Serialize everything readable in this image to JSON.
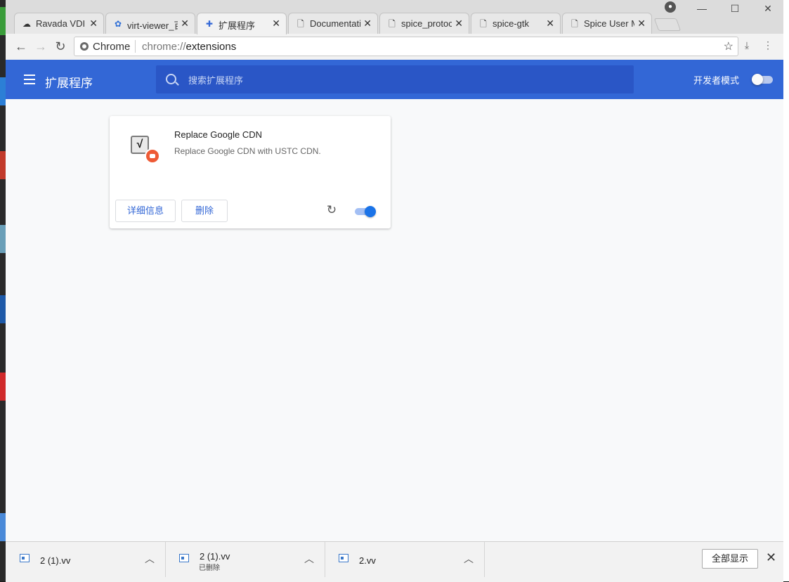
{
  "tabs": [
    {
      "label": "Ravada VDI",
      "icon": "cloud-icon"
    },
    {
      "label": "virt-viewer_百度",
      "icon": "baidu-paw-icon"
    },
    {
      "label": "扩展程序",
      "icon": "puzzle-icon",
      "active": true
    },
    {
      "label": "Documentation",
      "icon": "page-icon"
    },
    {
      "label": "spice_protocol",
      "icon": "page-icon"
    },
    {
      "label": "spice-gtk",
      "icon": "page-icon"
    },
    {
      "label": "Spice User Manual",
      "icon": "page-icon"
    }
  ],
  "toolbar": {
    "scheme_label": "Chrome",
    "url_prefix": "chrome://",
    "url_host": "extensions"
  },
  "header": {
    "title": "扩展程序",
    "search_placeholder": "搜索扩展程序",
    "dev_mode_label": "开发者模式",
    "dev_mode_on": false
  },
  "extension": {
    "name": "Replace Google CDN",
    "description": "Replace Google CDN with USTC CDN.",
    "details_label": "详细信息",
    "remove_label": "删除",
    "enabled": true
  },
  "downloads": {
    "items": [
      {
        "name": "2 (1).vv",
        "status": ""
      },
      {
        "name": "2 (1).vv",
        "status": "已删除"
      },
      {
        "name": "2.vv",
        "status": ""
      }
    ],
    "show_all_label": "全部显示"
  },
  "colors": {
    "header_blue": "#3367d6",
    "search_bg": "#2a56c6",
    "toggle_on": "#1a73e8"
  }
}
